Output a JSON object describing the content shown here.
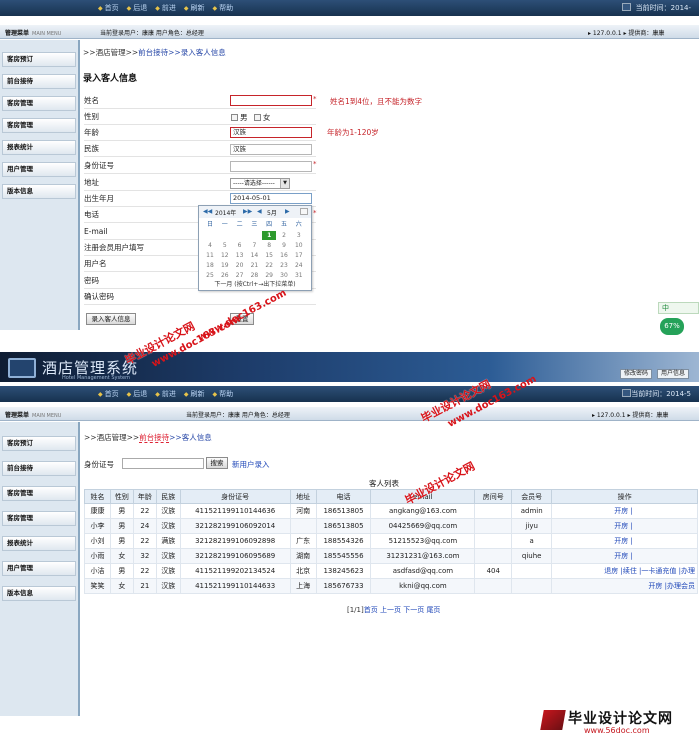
{
  "nav": {
    "home": "首页",
    "back": "后退",
    "forward": "前进",
    "refresh": "刷新",
    "help": "帮助",
    "time_label": "当前时间：2014-",
    "time_label_2": "当前时间：2014-5"
  },
  "infobar": {
    "menu_title": "管理菜单",
    "menu_sub": "MAIN MENU",
    "current_user_1": "当前登录用户：康康  用户角色：总经理",
    "current_user_2": "当前登录用户：康康  用户角色：总经理",
    "ip": "▸ 127.0.0.1   ▸ 提供商：康康",
    "ip_2": "▸ 127.0.0.1   ▸ 提供商：康康"
  },
  "sidebar": {
    "items": [
      "客房预订",
      "前台接待",
      "客房管理",
      "客房管理",
      "报表统计",
      "用户管理",
      "版本信息"
    ]
  },
  "form": {
    "breadcrumb_root": ">>酒店管理>>",
    "breadcrumb_mid": "前台接待",
    "breadcrumb_leaf": ">>录入客人信息",
    "title": "录入客人信息",
    "labels": {
      "name": "姓名",
      "gender": "性别",
      "age": "年龄",
      "ethnicity": "民族",
      "id_no": "身份证号",
      "address": "地址",
      "birth": "出生年月",
      "phone": "电话",
      "email": "E-mail",
      "register": "注册会员用户填写",
      "username": "用户名",
      "password": "密码",
      "confirm": "确认密码"
    },
    "values": {
      "name": "",
      "age": "汉族",
      "ethnicity": "汉族",
      "address": "-----请选择------",
      "birth": "2014-05-01"
    },
    "gender_male": "男",
    "gender_female": "女",
    "star": "*",
    "hint_name": "姓名1到4位，且不能为数字",
    "hint_age": "年龄为1-120岁",
    "submit": "录入客人信息",
    "reset": "重置"
  },
  "calendar": {
    "year": "2014年",
    "month": "5月",
    "weekdays": [
      "日",
      "一",
      "二",
      "三",
      "四",
      "五",
      "六"
    ],
    "days": [
      [
        "",
        "",
        "",
        "",
        "1",
        "2",
        "3"
      ],
      [
        "4",
        "5",
        "6",
        "7",
        "8",
        "9",
        "10"
      ],
      [
        "11",
        "12",
        "13",
        "14",
        "15",
        "16",
        "17"
      ],
      [
        "18",
        "19",
        "20",
        "21",
        "22",
        "23",
        "24"
      ],
      [
        "25",
        "26",
        "27",
        "28",
        "29",
        "30",
        "31"
      ]
    ],
    "footer": "下一月 (按Ctrl+→出下拉菜单)"
  },
  "banner": {
    "logo": "酒店管理系统",
    "sub": "Hotel Management System",
    "btn_pwd": "修改密码",
    "btn_info": "用户信息"
  },
  "list": {
    "breadcrumb_root": ">>酒店管理>>",
    "breadcrumb_mid": "前台接待",
    "breadcrumb_leaf": ">>客人信息",
    "search_label": "身份证号",
    "search_btn": "搜索",
    "new_user": "新用户录入",
    "table_title": "客人列表",
    "headers": [
      "姓名",
      "性别",
      "年龄",
      "民族",
      "身份证号",
      "地址",
      "电话",
      "email",
      "房间号",
      "会员号",
      "操作"
    ],
    "rows": [
      [
        "康康",
        "男",
        "22",
        "汉族",
        "411521199110144636",
        "河南",
        "186513805",
        "angkang@163.com",
        "",
        "admin",
        "开房 |"
      ],
      [
        "小李",
        "男",
        "24",
        "汉族",
        "321282199106092014",
        "",
        "186513805",
        "04425669@qq.com",
        "",
        "jiyu",
        "开房 |"
      ],
      [
        "小刘",
        "男",
        "22",
        "满族",
        "321282199106092898",
        "广东",
        "188554326",
        "51215523@qq.com",
        "",
        "a",
        "开房 |"
      ],
      [
        "小雨",
        "女",
        "32",
        "汉族",
        "321282199106095689",
        "湖南",
        "185545556",
        "31231231@163.com",
        "",
        "qiuhe",
        "开房 |"
      ],
      [
        "小洁",
        "男",
        "22",
        "汉族",
        "411521199202134524",
        "北京",
        "138245623",
        "asdfasd@qq.com",
        "404",
        "",
        "退房 |续住 |一卡通充值 |办理"
      ],
      [
        "笑笑",
        "女",
        "21",
        "汉族",
        "411521199110144633",
        "上海",
        "185676733",
        "kkni@qq.com",
        "",
        "",
        "开房 |办理会员"
      ]
    ],
    "pager": "[1/1]",
    "first": "首页",
    "prev": "上一页",
    "next": "下一页",
    "last": "尾页"
  },
  "watermark": {
    "w1": "毕业设计论文网",
    "w2": "www.doc163.com",
    "w3": "毕业设计论文网",
    "w4": "www.doc163.com",
    "w5": "毕业设计论文网",
    "w6": "www.doc163.com"
  },
  "footer": {
    "t1": "毕业设计论文网",
    "t2": "www.56doc.com"
  },
  "mini": {
    "badge": "中",
    "percent": "67%"
  }
}
